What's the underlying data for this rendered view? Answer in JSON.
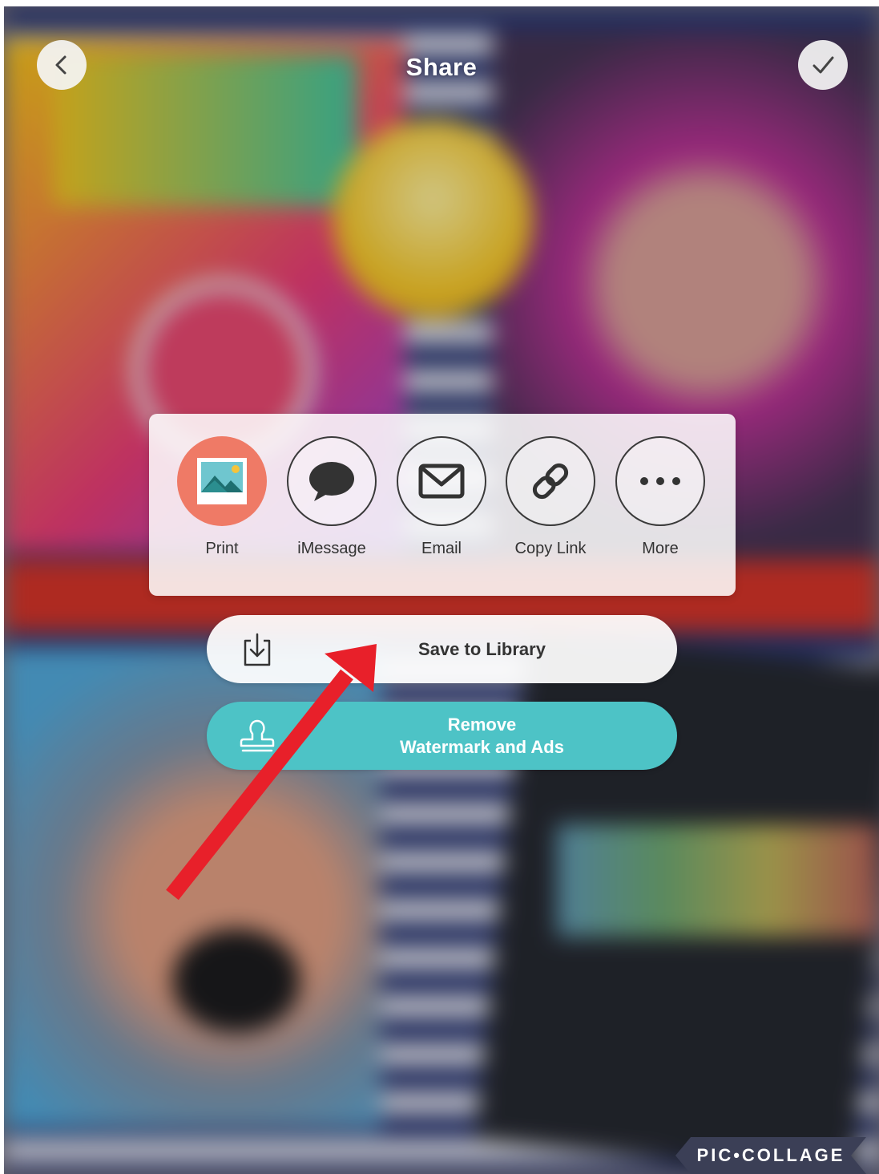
{
  "header": {
    "title": "Share",
    "back_icon": "chevron-left-icon",
    "done_icon": "checkmark-icon"
  },
  "share_options": [
    {
      "label": "Print",
      "icon": "print-photo-icon",
      "color": "#ef7a66"
    },
    {
      "label": "iMessage",
      "icon": "speech-bubble-icon"
    },
    {
      "label": "Email",
      "icon": "envelope-icon"
    },
    {
      "label": "Copy Link",
      "icon": "link-icon"
    },
    {
      "label": "More",
      "icon": "more-dots-icon"
    }
  ],
  "actions": {
    "save": {
      "label": "Save to Library",
      "icon": "download-tray-icon"
    },
    "remove": {
      "line1": "Remove",
      "line2": "Watermark and Ads",
      "icon": "stamp-icon",
      "color": "#4dc3c6"
    }
  },
  "annotation": {
    "arrow_color": "#e8202a"
  },
  "watermark": {
    "text": "PIC•COLLAGE"
  }
}
